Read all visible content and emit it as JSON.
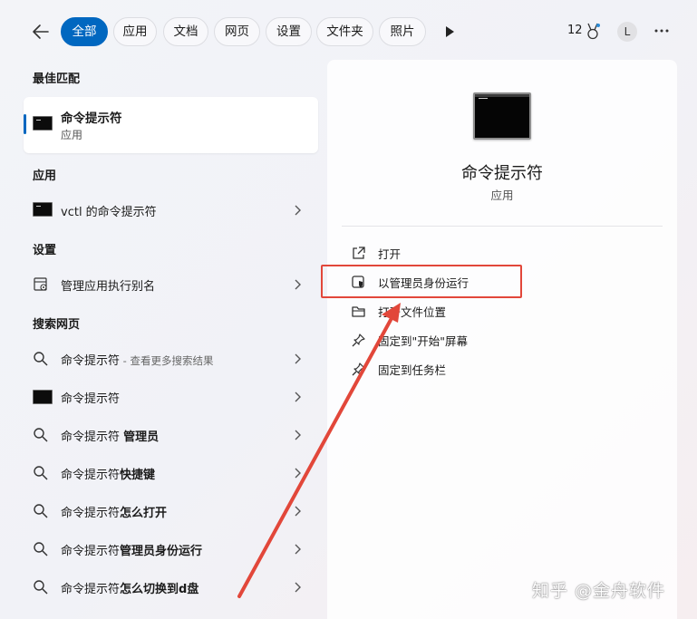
{
  "tabs": [
    {
      "label": "全部",
      "active": true
    },
    {
      "label": "应用",
      "active": false
    },
    {
      "label": "文档",
      "active": false
    },
    {
      "label": "网页",
      "active": false
    },
    {
      "label": "设置",
      "active": false
    },
    {
      "label": "文件夹",
      "active": false
    },
    {
      "label": "照片",
      "active": false
    }
  ],
  "header": {
    "rewards_count": "12",
    "avatar_letter": "L"
  },
  "sections": {
    "best_match": "最佳匹配",
    "apps": "应用",
    "settings": "设置",
    "web": "搜索网页"
  },
  "best_match": {
    "title": "命令提示符",
    "subtitle": "应用"
  },
  "apps": [
    {
      "label": "vctl 的命令提示符"
    }
  ],
  "settings": [
    {
      "label": "管理应用执行别名"
    }
  ],
  "web_results": [
    {
      "prefix": "命令提示符",
      "bold": "",
      "hint": " - 查看更多搜索结果",
      "icon": "search-icon"
    },
    {
      "prefix": "命令提示符",
      "bold": "",
      "hint": "",
      "icon": "cmd-icon"
    },
    {
      "prefix": "命令提示符 ",
      "bold": "管理员",
      "hint": "",
      "icon": "search-icon"
    },
    {
      "prefix": "命令提示符",
      "bold": "快捷键",
      "hint": "",
      "icon": "search-icon"
    },
    {
      "prefix": "命令提示符",
      "bold": "怎么打开",
      "hint": "",
      "icon": "search-icon"
    },
    {
      "prefix": "命令提示符",
      "bold": "管理员身份运行",
      "hint": "",
      "icon": "search-icon"
    },
    {
      "prefix": "命令提示符",
      "bold": "怎么切换到d盘",
      "hint": "",
      "icon": "search-icon"
    }
  ],
  "detail": {
    "title": "命令提示符",
    "type": "应用",
    "actions": [
      {
        "label": "打开",
        "icon": "open-external-icon"
      },
      {
        "label": "以管理员身份运行",
        "icon": "shield-admin-icon"
      },
      {
        "label": "打开文件位置",
        "icon": "folder-icon"
      },
      {
        "label": "固定到\"开始\"屏幕",
        "icon": "pin-icon"
      },
      {
        "label": "固定到任务栏",
        "icon": "pin-icon"
      }
    ]
  },
  "annotation": {
    "color": "#e2473a"
  },
  "watermark": "知乎 @金舟软件",
  "colors": {
    "accent": "#0067c0",
    "background": "#f2f3f8"
  }
}
